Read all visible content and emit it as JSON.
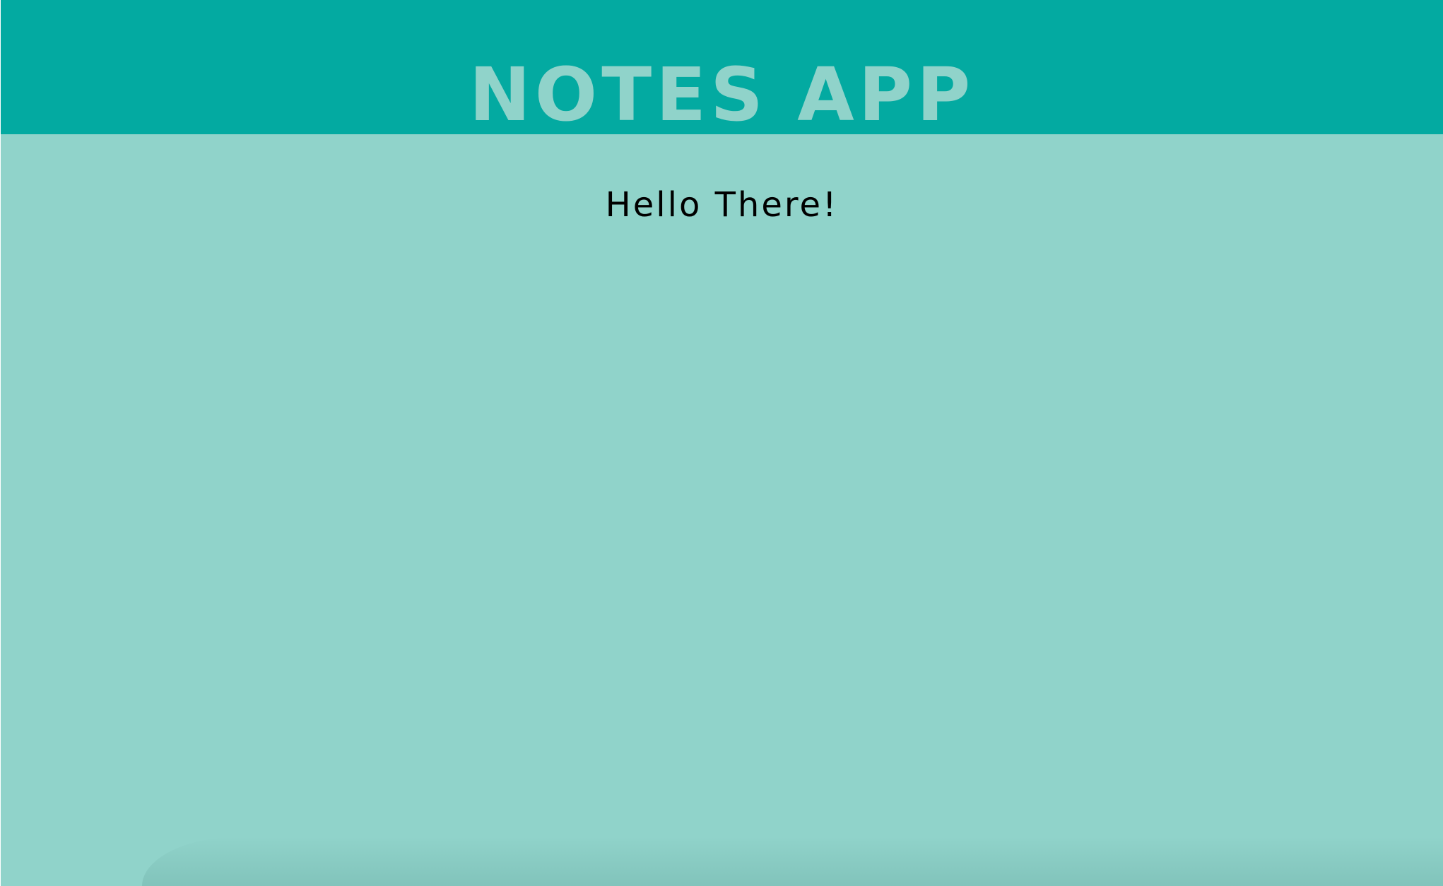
{
  "header": {
    "title": "NOTES APP"
  },
  "main": {
    "note_text": "Hello There!"
  },
  "colors": {
    "header_background": "#03aaa1",
    "page_background": "#90d3ca",
    "title_text": "#90d3ca",
    "note_text": "#000000"
  }
}
